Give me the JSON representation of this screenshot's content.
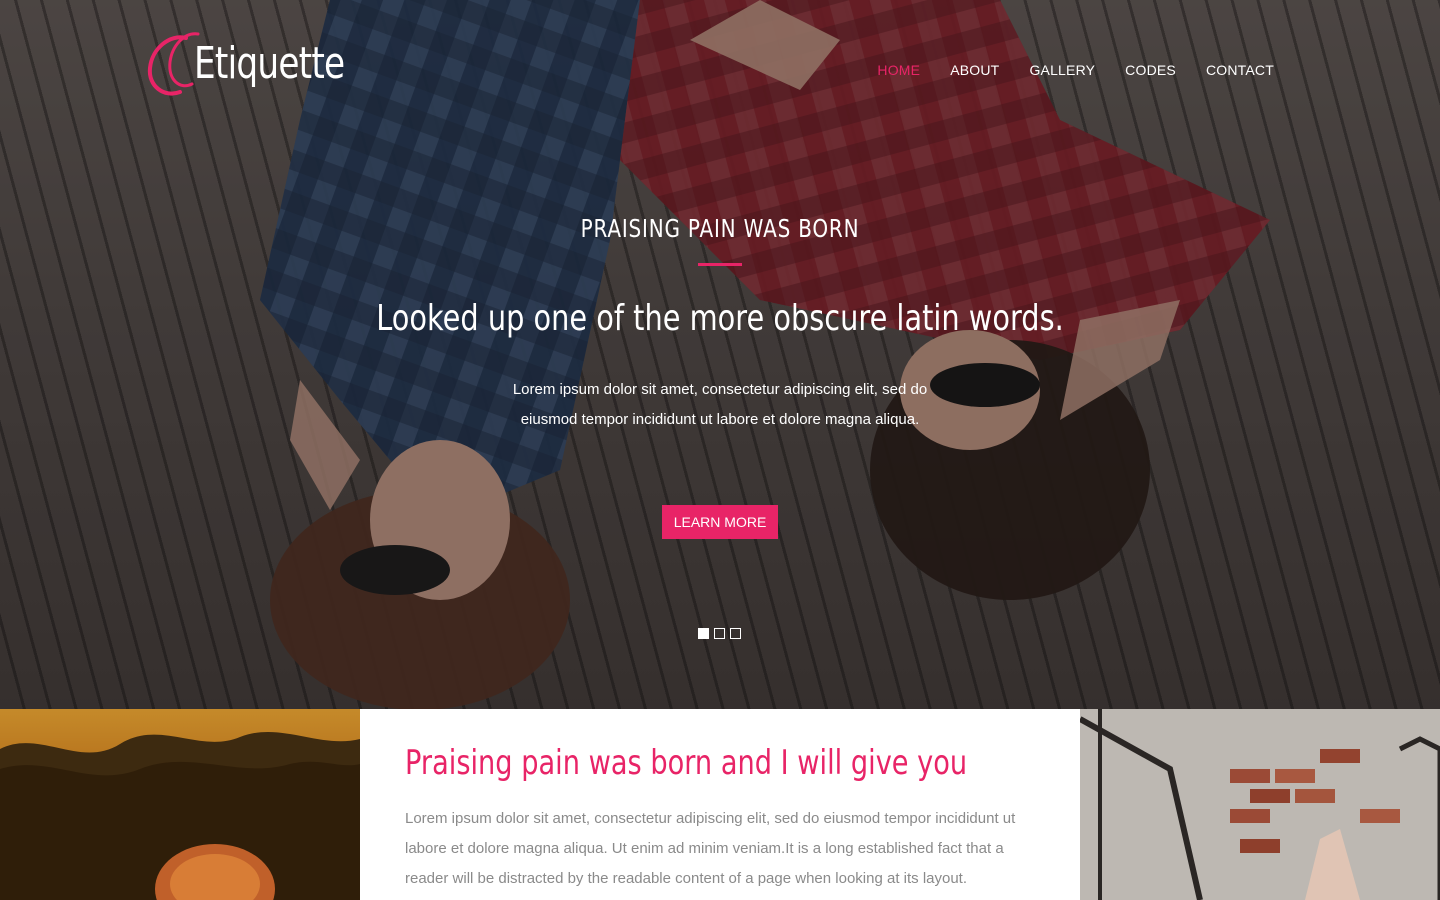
{
  "brand": {
    "name": "Etiquette",
    "accent_color": "#e82467"
  },
  "nav": {
    "items": [
      {
        "label": "HOME",
        "active": true
      },
      {
        "label": "ABOUT",
        "active": false
      },
      {
        "label": "GALLERY",
        "active": false
      },
      {
        "label": "CODES",
        "active": false
      },
      {
        "label": "CONTACT",
        "active": false
      }
    ]
  },
  "hero": {
    "subtitle": "PRAISING PAIN WAS BORN",
    "title": "Looked up one of the more obscure latin words.",
    "text": "Lorem ipsum dolor sit amet, consectetur adipiscing elit, sed do eiusmod tempor incididunt ut labore et dolore magna aliqua.",
    "button_label": "LEARN MORE",
    "slides": {
      "count": 3,
      "active_index": 0
    }
  },
  "section": {
    "title": "Praising pain was born and I will give you",
    "text": "Lorem ipsum dolor sit amet, consectetur adipiscing elit, sed do eiusmod tempor incididunt ut labore et dolore magna aliqua. Ut enim ad minim veniam.It is a long established fact that a reader will be distracted by the readable content of a page when looking at its layout."
  }
}
